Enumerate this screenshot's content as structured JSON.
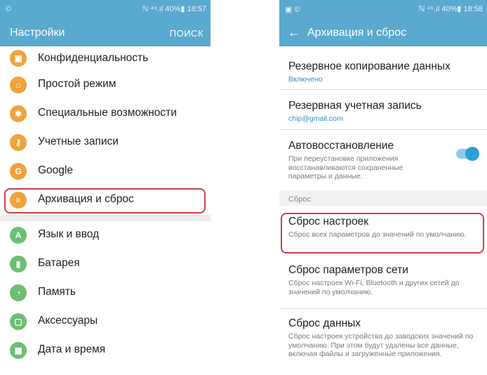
{
  "left": {
    "status": {
      "left_icon": "©",
      "right_text": "ℕ ⁴⁶.ıl 40%▮ 18:57"
    },
    "appbar": {
      "title": "Настройки",
      "search": "ПОИСК"
    },
    "items": [
      {
        "label": "Конфиденциальность",
        "icon": "lock-icon",
        "color": "#f0a33a",
        "glyph": "▣"
      },
      {
        "label": "Простой режим",
        "icon": "home-icon",
        "color": "#f0a33a",
        "glyph": "⌂"
      },
      {
        "label": "Специальные возможности",
        "icon": "accessibility-icon",
        "color": "#f0a33a",
        "glyph": "✱"
      },
      {
        "label": "Учетные записи",
        "icon": "key-icon",
        "color": "#f0a33a",
        "glyph": "⚷"
      },
      {
        "label": "Google",
        "icon": "google-icon",
        "color": "#f0a33a",
        "glyph": "G"
      },
      {
        "label": "Архивация и сброс",
        "icon": "backup-icon",
        "color": "#f0a33a",
        "glyph": "≡"
      },
      {
        "label": "Язык и ввод",
        "icon": "language-icon",
        "color": "#6bbf72",
        "glyph": "A"
      },
      {
        "label": "Батарея",
        "icon": "battery-icon",
        "color": "#6bbf72",
        "glyph": "▮"
      },
      {
        "label": "Память",
        "icon": "storage-icon",
        "color": "#6bbf72",
        "glyph": "◔"
      },
      {
        "label": "Аксессуары",
        "icon": "accessories-icon",
        "color": "#6bbf72",
        "glyph": "▢"
      },
      {
        "label": "Дата и время",
        "icon": "calendar-icon",
        "color": "#6bbf72",
        "glyph": "▦"
      }
    ]
  },
  "right": {
    "status": {
      "left_icon": "▣ ©",
      "right_text": "ℕ ⁴⁶.ıl 40%▮ 18:58"
    },
    "appbar": {
      "back": "←",
      "title": "Архивация и сброс"
    },
    "items": [
      {
        "title": "Резервное копирование данных",
        "sub": "Включено"
      },
      {
        "title": "Резервная учетная запись",
        "sub": "chip@gmail.com"
      },
      {
        "title": "Автовосстановление",
        "desc": "При переустановке приложения восстанавливаются сохраненные параметры и данные.",
        "toggle": true
      }
    ],
    "section": "Сброс",
    "reset_items": [
      {
        "title": "Сброс настроек",
        "desc": "Сброс всех параметров до значений по умолчанию."
      },
      {
        "title": "Сброс параметров сети",
        "desc": "Сброс настроек Wi-Fi, Bluetooth и других сетей до значений по умолчанию."
      },
      {
        "title": "Сброс данных",
        "desc": "Сброс настроек устройства до заводских значений по умолчанию. При этом будут удалены все данные, включая файлы и загруженные приложения."
      }
    ],
    "colors": {
      "accent": "#5aa9cf",
      "toggle": "#2b9fd6",
      "highlight": "#c9404b"
    }
  }
}
